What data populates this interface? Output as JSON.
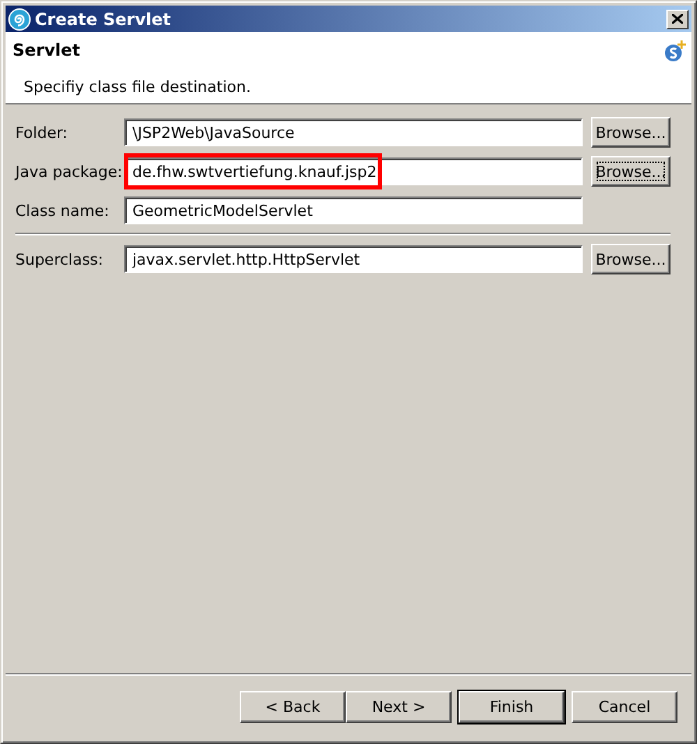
{
  "window": {
    "title": "Create Servlet"
  },
  "header": {
    "title": "Servlet",
    "description": "Specifiy class file destination."
  },
  "fields": [
    {
      "label": "Folder:",
      "value": "\\JSP2Web\\JavaSource",
      "button": "Browse...",
      "focused": false,
      "highlighted": false
    },
    {
      "label": "Java package:",
      "value": "de.fhw.swtvertiefung.knauf.jsp2",
      "button": "Browse...",
      "focused": true,
      "highlighted": true
    },
    {
      "label": "Class name:",
      "value": "GeometricModelServlet",
      "highlighted": false
    },
    {
      "label": "Superclass:",
      "value": "javax.servlet.http.HttpServlet",
      "button": "Browse...",
      "focused": false,
      "highlighted": false,
      "separated": true
    }
  ],
  "buttons": [
    {
      "label": "< Back",
      "default": false
    },
    {
      "label": "Next >",
      "default": false
    },
    {
      "label": "Finish",
      "default": true
    },
    {
      "label": "Cancel",
      "default": false
    }
  ]
}
